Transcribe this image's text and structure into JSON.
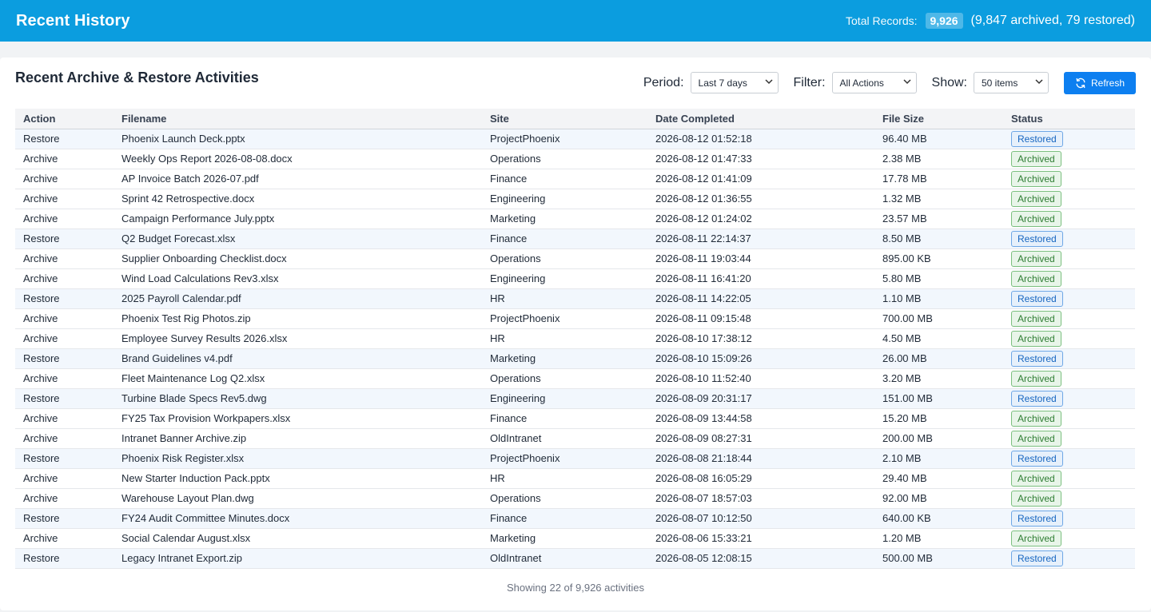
{
  "header": {
    "title": "Recent History",
    "total_label": "Total Records:",
    "total_value": "9,926",
    "total_detail": "(9,847 archived, 79 restored)"
  },
  "panel": {
    "title": "Recent Archive & Restore Activities",
    "period_label": "Period:",
    "period_value": "Last 7 days",
    "filter_label": "Filter:",
    "filter_value": "All Actions",
    "show_label": "Show:",
    "show_value": "50 items",
    "refresh_label": "Refresh"
  },
  "table": {
    "columns": [
      "Action",
      "Filename",
      "Site",
      "Date Completed",
      "File Size",
      "Status"
    ],
    "rows": [
      {
        "action": "Restore",
        "filename": "Phoenix Launch Deck.pptx",
        "site": "ProjectPhoenix",
        "date": "2026-08-12 01:52:18",
        "size": "96.40 MB",
        "status": "Restored"
      },
      {
        "action": "Archive",
        "filename": "Weekly Ops Report 2026-08-08.docx",
        "site": "Operations",
        "date": "2026-08-12 01:47:33",
        "size": "2.38 MB",
        "status": "Archived"
      },
      {
        "action": "Archive",
        "filename": "AP Invoice Batch 2026-07.pdf",
        "site": "Finance",
        "date": "2026-08-12 01:41:09",
        "size": "17.78 MB",
        "status": "Archived"
      },
      {
        "action": "Archive",
        "filename": "Sprint 42 Retrospective.docx",
        "site": "Engineering",
        "date": "2026-08-12 01:36:55",
        "size": "1.32 MB",
        "status": "Archived"
      },
      {
        "action": "Archive",
        "filename": "Campaign Performance July.pptx",
        "site": "Marketing",
        "date": "2026-08-12 01:24:02",
        "size": "23.57 MB",
        "status": "Archived"
      },
      {
        "action": "Restore",
        "filename": "Q2 Budget Forecast.xlsx",
        "site": "Finance",
        "date": "2026-08-11 22:14:37",
        "size": "8.50 MB",
        "status": "Restored"
      },
      {
        "action": "Archive",
        "filename": "Supplier Onboarding Checklist.docx",
        "site": "Operations",
        "date": "2026-08-11 19:03:44",
        "size": "895.00 KB",
        "status": "Archived"
      },
      {
        "action": "Archive",
        "filename": "Wind Load Calculations Rev3.xlsx",
        "site": "Engineering",
        "date": "2026-08-11 16:41:20",
        "size": "5.80 MB",
        "status": "Archived"
      },
      {
        "action": "Restore",
        "filename": "2025 Payroll Calendar.pdf",
        "site": "HR",
        "date": "2026-08-11 14:22:05",
        "size": "1.10 MB",
        "status": "Restored"
      },
      {
        "action": "Archive",
        "filename": "Phoenix Test Rig Photos.zip",
        "site": "ProjectPhoenix",
        "date": "2026-08-11 09:15:48",
        "size": "700.00 MB",
        "status": "Archived"
      },
      {
        "action": "Archive",
        "filename": "Employee Survey Results 2026.xlsx",
        "site": "HR",
        "date": "2026-08-10 17:38:12",
        "size": "4.50 MB",
        "status": "Archived"
      },
      {
        "action": "Restore",
        "filename": "Brand Guidelines v4.pdf",
        "site": "Marketing",
        "date": "2026-08-10 15:09:26",
        "size": "26.00 MB",
        "status": "Restored"
      },
      {
        "action": "Archive",
        "filename": "Fleet Maintenance Log Q2.xlsx",
        "site": "Operations",
        "date": "2026-08-10 11:52:40",
        "size": "3.20 MB",
        "status": "Archived"
      },
      {
        "action": "Restore",
        "filename": "Turbine Blade Specs Rev5.dwg",
        "site": "Engineering",
        "date": "2026-08-09 20:31:17",
        "size": "151.00 MB",
        "status": "Restored"
      },
      {
        "action": "Archive",
        "filename": "FY25 Tax Provision Workpapers.xlsx",
        "site": "Finance",
        "date": "2026-08-09 13:44:58",
        "size": "15.20 MB",
        "status": "Archived"
      },
      {
        "action": "Archive",
        "filename": "Intranet Banner Archive.zip",
        "site": "OldIntranet",
        "date": "2026-08-09 08:27:31",
        "size": "200.00 MB",
        "status": "Archived"
      },
      {
        "action": "Restore",
        "filename": "Phoenix Risk Register.xlsx",
        "site": "ProjectPhoenix",
        "date": "2026-08-08 21:18:44",
        "size": "2.10 MB",
        "status": "Restored"
      },
      {
        "action": "Archive",
        "filename": "New Starter Induction Pack.pptx",
        "site": "HR",
        "date": "2026-08-08 16:05:29",
        "size": "29.40 MB",
        "status": "Archived"
      },
      {
        "action": "Archive",
        "filename": "Warehouse Layout Plan.dwg",
        "site": "Operations",
        "date": "2026-08-07 18:57:03",
        "size": "92.00 MB",
        "status": "Archived"
      },
      {
        "action": "Restore",
        "filename": "FY24 Audit Committee Minutes.docx",
        "site": "Finance",
        "date": "2026-08-07 10:12:50",
        "size": "640.00 KB",
        "status": "Restored"
      },
      {
        "action": "Archive",
        "filename": "Social Calendar August.xlsx",
        "site": "Marketing",
        "date": "2026-08-06 15:33:21",
        "size": "1.20 MB",
        "status": "Archived"
      },
      {
        "action": "Restore",
        "filename": "Legacy Intranet Export.zip",
        "site": "OldIntranet",
        "date": "2026-08-05 12:08:15",
        "size": "500.00 MB",
        "status": "Restored"
      }
    ]
  },
  "footer": {
    "summary": "Showing 22 of 9,926 activities"
  },
  "colors": {
    "header_bg": "#0b9ddf",
    "refresh_bg": "#0d7ff0",
    "archived": "#2e7d32",
    "restored": "#1565c0"
  }
}
